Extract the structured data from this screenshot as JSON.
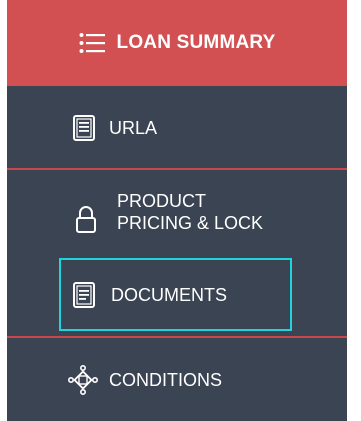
{
  "colors": {
    "nav_background": "#3a4452",
    "header_background": "#d24f52",
    "divider": "#c8474b",
    "highlight_border": "#1fd4dc",
    "text": "#ffffff"
  },
  "header": {
    "label": "LOAN SUMMARY",
    "icon": "list-icon"
  },
  "nav_items": [
    {
      "label": "URLA",
      "icon": "document-list-icon"
    },
    {
      "label_line1": "PRODUCT",
      "label_line2": "PRICING & LOCK",
      "icon": "lock-icon"
    },
    {
      "label": "DOCUMENTS",
      "icon": "documents-icon",
      "highlighted": true
    },
    {
      "label": "CONDITIONS",
      "icon": "conditions-icon"
    }
  ]
}
